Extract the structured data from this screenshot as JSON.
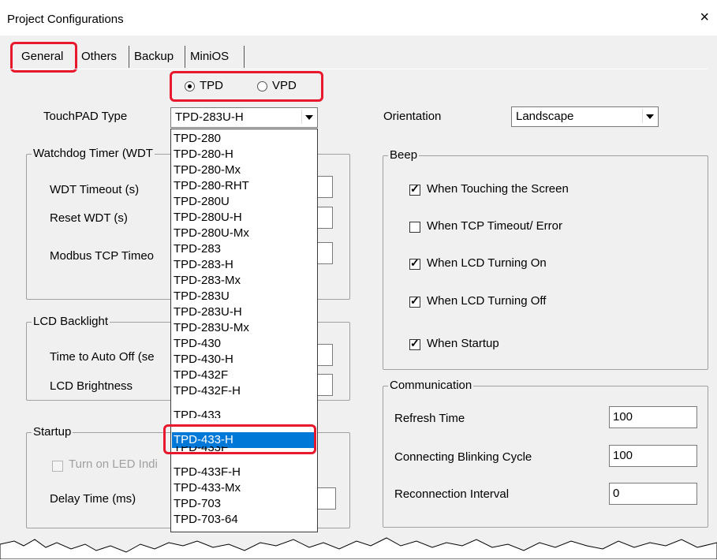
{
  "window": {
    "title": "Project Configurations",
    "close_label": "×"
  },
  "tabs": [
    {
      "label": "General",
      "active": true
    },
    {
      "label": "Others"
    },
    {
      "label": "Backup"
    },
    {
      "label": "MiniOS"
    }
  ],
  "device_type": {
    "options": [
      "TPD",
      "VPD"
    ],
    "selected": "TPD"
  },
  "touchpad_type": {
    "label": "TouchPAD Type",
    "value": "TPD-283U-H"
  },
  "orientation": {
    "label": "Orientation",
    "value": "Landscape"
  },
  "watchdog": {
    "title": "Watchdog Timer (WDT",
    "fields": [
      "WDT Timeout (s)",
      "Reset WDT (s)",
      "Modbus TCP Timeo"
    ]
  },
  "lcd_backlight": {
    "title": "LCD Backlight",
    "fields": [
      "Time to Auto Off (se",
      "LCD Brightness"
    ]
  },
  "startup": {
    "title": "Startup",
    "led_label": "Turn on LED Indi",
    "delay_label": "Delay Time (ms)"
  },
  "beep": {
    "title": "Beep",
    "options": [
      {
        "label": "When Touching the Screen",
        "checked": true
      },
      {
        "label": "When TCP Timeout/ Error",
        "checked": false
      },
      {
        "label": "When LCD Turning On",
        "checked": true
      },
      {
        "label": "When LCD Turning Off",
        "checked": true
      },
      {
        "label": "When Startup",
        "checked": true
      }
    ]
  },
  "communication": {
    "title": "Communication",
    "fields": [
      {
        "label": "Refresh Time",
        "value": "100"
      },
      {
        "label": "Connecting Blinking Cycle",
        "value": "100"
      },
      {
        "label": "Reconnection Interval",
        "value": "0"
      }
    ]
  },
  "dropdown": {
    "items": [
      "TPD-280",
      "TPD-280-H",
      "TPD-280-Mx",
      "TPD-280-RHT",
      "TPD-280U",
      "TPD-280U-H",
      "TPD-280U-Mx",
      "TPD-283",
      "TPD-283-H",
      "TPD-283-Mx",
      "TPD-283U",
      "TPD-283U-H",
      "TPD-283U-Mx",
      "TPD-430",
      "TPD-430-H",
      "TPD-432F",
      "TPD-432F-H",
      "TPD-433"
    ],
    "selected": "TPD-433-H",
    "items_after": [
      "TPD-433F",
      "TPD-433F-H",
      "TPD-433-Mx",
      "TPD-703",
      "TPD-703-64"
    ]
  },
  "colors": {
    "highlight": "#e8192c",
    "selection": "#0078d7"
  }
}
